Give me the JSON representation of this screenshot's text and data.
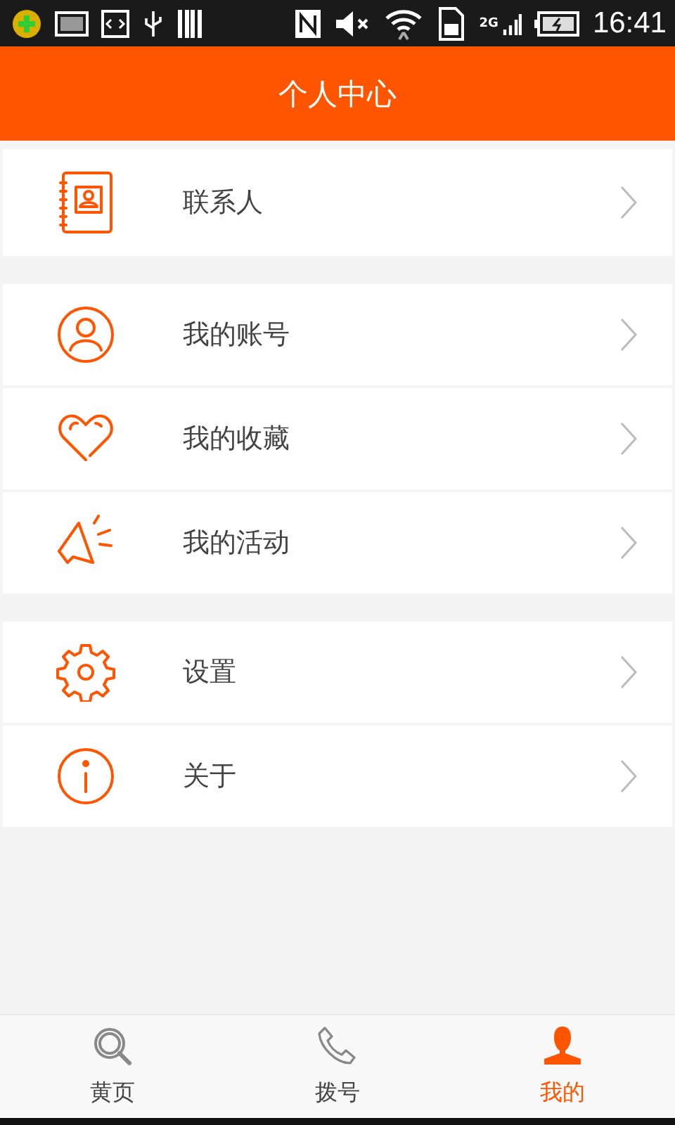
{
  "status_bar": {
    "network": "2G",
    "time": "16:41"
  },
  "header": {
    "title": "个人中心"
  },
  "groups": [
    {
      "items": [
        {
          "label": "联系人"
        }
      ]
    },
    {
      "items": [
        {
          "label": "我的账号"
        },
        {
          "label": "我的收藏"
        },
        {
          "label": "我的活动"
        }
      ]
    },
    {
      "items": [
        {
          "label": "设置"
        },
        {
          "label": "关于"
        }
      ]
    }
  ],
  "tabs": [
    {
      "label": "黄页",
      "selected": false
    },
    {
      "label": "拨号",
      "selected": false
    },
    {
      "label": "我的",
      "selected": true
    }
  ]
}
